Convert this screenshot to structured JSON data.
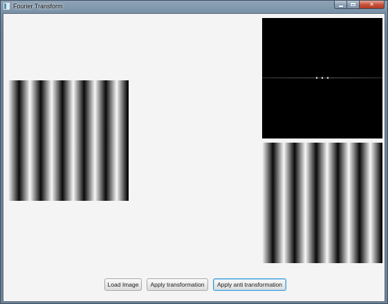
{
  "window": {
    "title": "Fourier Transform"
  },
  "caption_buttons": {
    "minimize_icon": "minimize-icon",
    "maximize_icon": "maximize-icon",
    "close_icon": "close-icon",
    "close_glyph": "✕"
  },
  "images": {
    "source": "vertical sinusoidal stripe pattern",
    "spectrum": "fourier magnitude spectrum",
    "result": "inverse transform stripe pattern"
  },
  "toolbar": {
    "load_label": "Load Image",
    "apply_label": "Apply transformation",
    "apply_anti_label": "Apply anti transformation"
  },
  "colors": {
    "focus_border": "#3b9ad9",
    "close_button": "#c8523c"
  }
}
